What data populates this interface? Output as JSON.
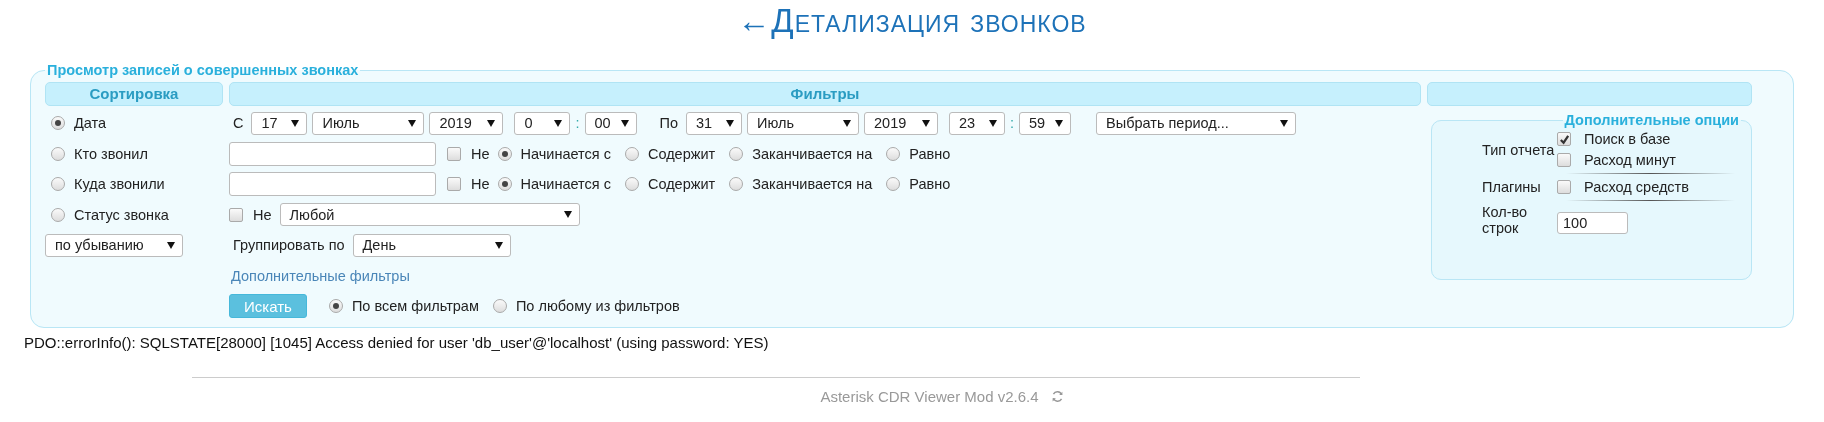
{
  "page_title": "←Детализация звонков",
  "form": {
    "legend": "Просмотр записей о совершенных звонках",
    "sort": {
      "header": "Сортировка",
      "options": [
        {
          "label": "Дата",
          "selected": true
        },
        {
          "label": "Кто звонил",
          "selected": false
        },
        {
          "label": "Куда звонили",
          "selected": false
        },
        {
          "label": "Статус звонка",
          "selected": false
        }
      ],
      "order": "по убыванию"
    },
    "filters": {
      "header": "Фильтры",
      "from": {
        "label": "С",
        "day": "17",
        "month": "Июль",
        "year": "2019",
        "hour": "0",
        "separator": ":",
        "minute": "00"
      },
      "to": {
        "label": "По",
        "day": "31",
        "month": "Июль",
        "year": "2019",
        "hour": "23",
        "separator": ":",
        "minute": "59"
      },
      "period": "Выбрать период...",
      "text_filters": [
        {
          "negate": false,
          "not_label": "Не",
          "modes": [
            {
              "label": "Начинается с",
              "selected": true
            },
            {
              "label": "Содержит",
              "selected": false
            },
            {
              "label": "Заканчивается на",
              "selected": false
            },
            {
              "label": "Равно",
              "selected": false
            }
          ]
        },
        {
          "negate": false,
          "not_label": "Не",
          "modes": [
            {
              "label": "Начинается с",
              "selected": true
            },
            {
              "label": "Содержит",
              "selected": false
            },
            {
              "label": "Заканчивается на",
              "selected": false
            },
            {
              "label": "Равно",
              "selected": false
            }
          ]
        }
      ],
      "status": {
        "negate": false,
        "not_label": "Не",
        "value": "Любой"
      },
      "group": {
        "label": "Группировать по",
        "value": "День"
      },
      "more_link": "Дополнительные фильтры",
      "search_button": "Искать",
      "match": [
        {
          "label": "По всем фильтрам",
          "selected": true
        },
        {
          "label": "По любому из фильтров",
          "selected": false
        }
      ]
    },
    "options": {
      "legend": "Дополнительные опции",
      "sections": [
        {
          "label": "Тип отчета",
          "kind": "checks",
          "items": [
            {
              "label": "Поиск в базе",
              "checked": true
            },
            {
              "label": "Расход минут",
              "checked": false
            }
          ]
        },
        {
          "label": "Плагины",
          "kind": "checks",
          "items": [
            {
              "label": "Расход средств",
              "checked": false
            }
          ]
        },
        {
          "label": "Кол-во строк",
          "kind": "input",
          "value": "100"
        }
      ]
    }
  },
  "error": "PDO::errorInfo(): SQLSTATE[28000] [1045] Access denied for user 'db_user'@'localhost' (using password: YES)",
  "footer": {
    "text": "Asterisk CDR Viewer Mod v2.6.4"
  }
}
